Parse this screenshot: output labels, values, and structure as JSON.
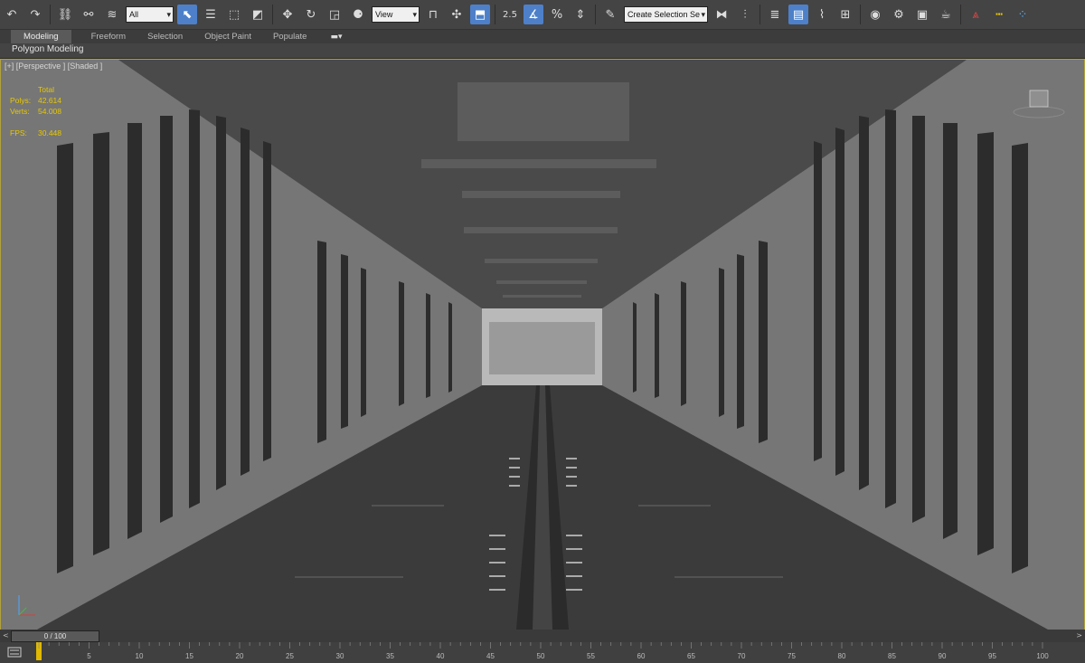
{
  "toolbar": {
    "filter_value": "All",
    "refcoord_value": "View",
    "snap_angle_label": "2.5",
    "selection_set_placeholder": "Create Selection Se"
  },
  "ribbon": {
    "tabs": [
      "Modeling",
      "Freeform",
      "Selection",
      "Object Paint",
      "Populate"
    ],
    "active_tab": "Modeling",
    "panel_label": "Polygon Modeling"
  },
  "viewport": {
    "label": "[+] [Perspective ] [Shaded ]",
    "stats": {
      "header": "Total",
      "polys_label": "Polys:",
      "polys_value": "42.614",
      "verts_label": "Verts:",
      "verts_value": "54.008",
      "fps_label": "FPS:",
      "fps_value": "30.448"
    },
    "border_color": "#b2a13a",
    "stats_color": "#e8c800"
  },
  "timeline": {
    "frame_display": "0 / 100",
    "prev_arrow": "<",
    "next_arrow": ">",
    "ticks": [
      5,
      10,
      15,
      20,
      25,
      30,
      35,
      40,
      45,
      50,
      55,
      60,
      65,
      70,
      75,
      80,
      85,
      90,
      95,
      100
    ]
  },
  "colors": {
    "accent_blue": "#4d80c9",
    "ui_bg": "#444444"
  }
}
